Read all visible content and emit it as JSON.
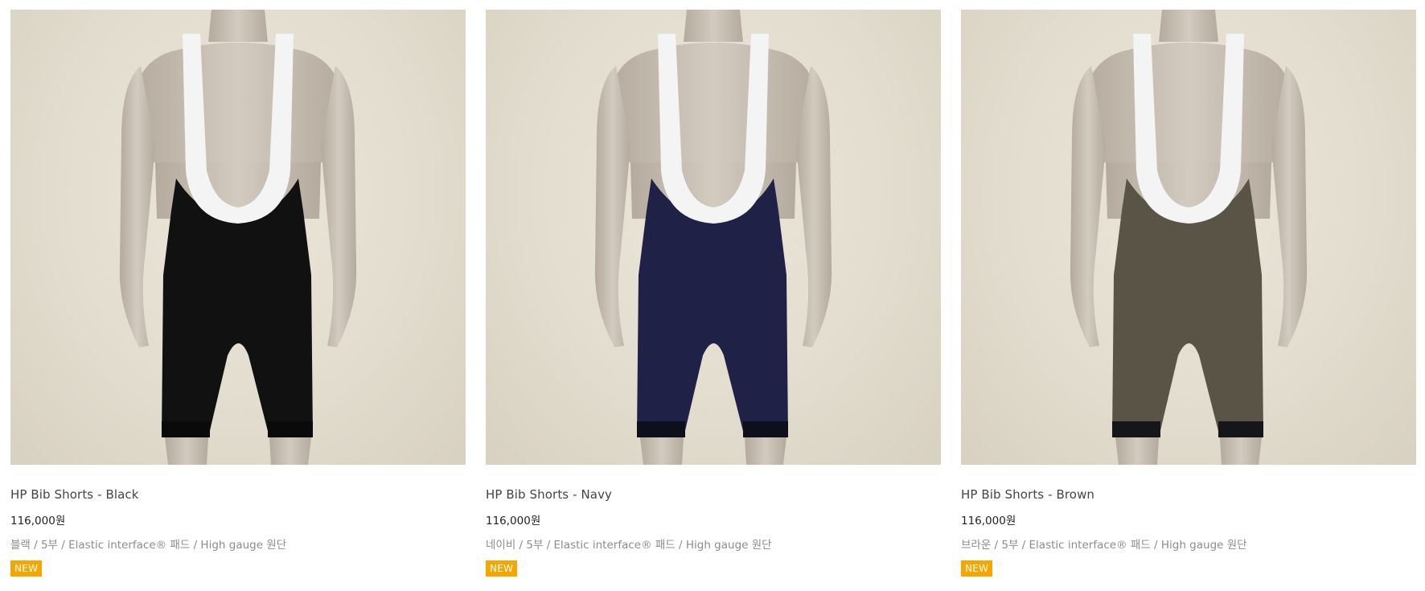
{
  "products": [
    {
      "name": "HP Bib Shorts - Black",
      "price": "116,000원",
      "description": "블랙 / 5부 / Elastic interface® 패드 / High gauge 원단",
      "badge": "NEW",
      "shorts_color": "#111111",
      "cuff_color": "#0a0a0a",
      "image_alt": "HP Bib Shorts Black on mannequin"
    },
    {
      "name": "HP Bib Shorts - Navy",
      "price": "116,000원",
      "description": "네이비 / 5부 / Elastic interface® 패드 / High gauge 원단",
      "badge": "NEW",
      "shorts_color": "#1f2147",
      "cuff_color": "#0d0f1c",
      "image_alt": "HP Bib Shorts Navy on mannequin"
    },
    {
      "name": "HP Bib Shorts - Brown",
      "price": "116,000원",
      "description": "브라운 / 5부 / Elastic interface® 패드 / High gauge 원단",
      "badge": "NEW",
      "shorts_color": "#5a5446",
      "cuff_color": "#14161a",
      "image_alt": "HP Bib Shorts Brown on mannequin"
    }
  ],
  "colors": {
    "badge": "#f5a700",
    "strap": "#f4f4f4",
    "mannequin": "#c9c0b4"
  }
}
